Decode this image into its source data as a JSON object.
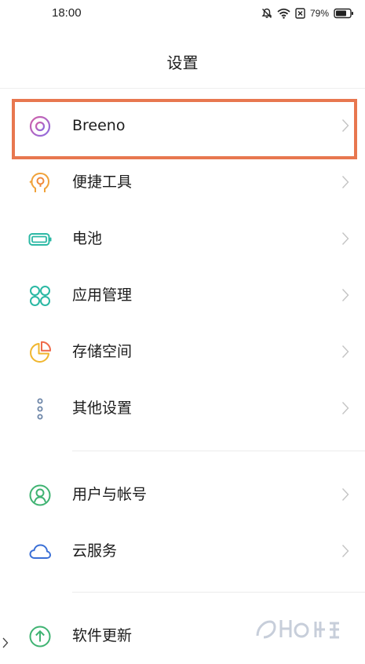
{
  "status_bar": {
    "time": "18:00",
    "battery_text": "79%",
    "icons": [
      "bell-muted-icon",
      "wifi-icon",
      "sim-off-icon",
      "battery-icon"
    ]
  },
  "header": {
    "title": "设置"
  },
  "settings": {
    "items": [
      {
        "label": "Breeno",
        "icon": "breeno-ring-icon"
      },
      {
        "label": "便捷工具",
        "icon": "head-bulb-icon"
      },
      {
        "label": "电池",
        "icon": "battery-icon"
      },
      {
        "label": "应用管理",
        "icon": "app-grid-icon"
      },
      {
        "label": "存储空间",
        "icon": "pie-storage-icon"
      },
      {
        "label": "其他设置",
        "icon": "dots-icon"
      },
      {
        "label": "用户与帐号",
        "icon": "user-icon"
      },
      {
        "label": "云服务",
        "icon": "cloud-icon"
      },
      {
        "label": "软件更新",
        "icon": "update-arrow-icon"
      }
    ]
  },
  "colors": {
    "highlight": "#e8774f",
    "breeno": "#b56bd6",
    "tools": "#f0a23a",
    "battery": "#2bb8a4",
    "apps": "#2bb8a4",
    "storage": "#f0b62e",
    "other": "#6d86a8",
    "user": "#3fb372",
    "cloud": "#3a6fd6",
    "update": "#3fb372"
  }
}
